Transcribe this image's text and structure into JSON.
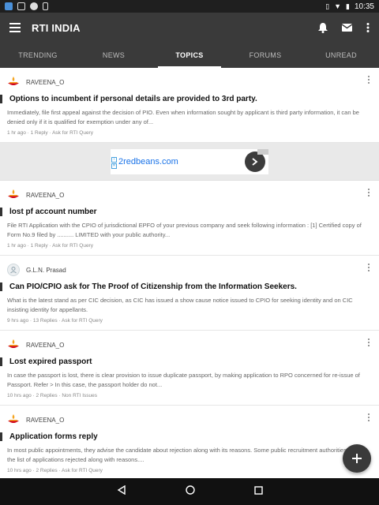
{
  "status_bar": {
    "time": "10:35"
  },
  "app": {
    "title": "RTI INDIA"
  },
  "tabs": [
    {
      "label": "TRENDING"
    },
    {
      "label": "NEWS"
    },
    {
      "label": "TOPICS"
    },
    {
      "label": "FORUMS"
    },
    {
      "label": "UNREAD"
    }
  ],
  "active_tab": "TOPICS",
  "ad": {
    "text": "2redbeans.com"
  },
  "posts": [
    {
      "user": "RAVEENA_O",
      "avatar": "diya-lamp-icon",
      "title": "Options to incumbent if personal details are provided to 3rd party.",
      "body": "Immediately, file first appeal against the decision of PIO. Even when information sought by applicant is third party information, it can be denied only if it is qualified for exemption under any of...",
      "meta": "1 hr ago  ·  1 Reply  ·  Ask for RTI Query"
    },
    {
      "user": "RAVEENA_O",
      "avatar": "diya-lamp-icon",
      "title": "lost pf account number",
      "body": "File RTI Application with the CPIO of jurisdictional EPFO of your previous company and seek following information : [1] Certified copy of Form No.9 filed by .......... LIMITED with your public authority...",
      "meta": "1 hr ago  ·  1 Reply  ·  Ask for RTI Query"
    },
    {
      "user": "G.L.N. Prasad",
      "avatar": "person-icon",
      "title": "Can PIO/CPIO ask for  The Proof of Citizenship from the Information Seekers.",
      "body": "What is the latest stand as per CIC decision, as CIC has issued a show cause notice issued to CPIO for seeking identity and on CIC insisting identity for appellants.",
      "meta": "9 hrs ago  ·  13 Replies  ·  Ask for RTI Query"
    },
    {
      "user": "RAVEENA_O",
      "avatar": "diya-lamp-icon",
      "title": "Lost expired passport",
      "body": "In case the passport is lost, there is clear provision to issue duplicate passport, by making application to RPO concerned for re-issue of Passport. Refer > In this case, the passport holder do not...",
      "meta": "10 hrs ago  ·  2 Replies  ·  Non RTI Issues"
    },
    {
      "user": "RAVEENA_O",
      "avatar": "diya-lamp-icon",
      "title": "Application forms reply",
      "body": "In most public appointments, they advise the candidate about rejection along with its reasons. Some public recruitment authorities display the list of applications rejected along with reasons....",
      "meta": "10 hrs ago  ·  2 Replies  ·  Ask for RTI Query"
    }
  ]
}
